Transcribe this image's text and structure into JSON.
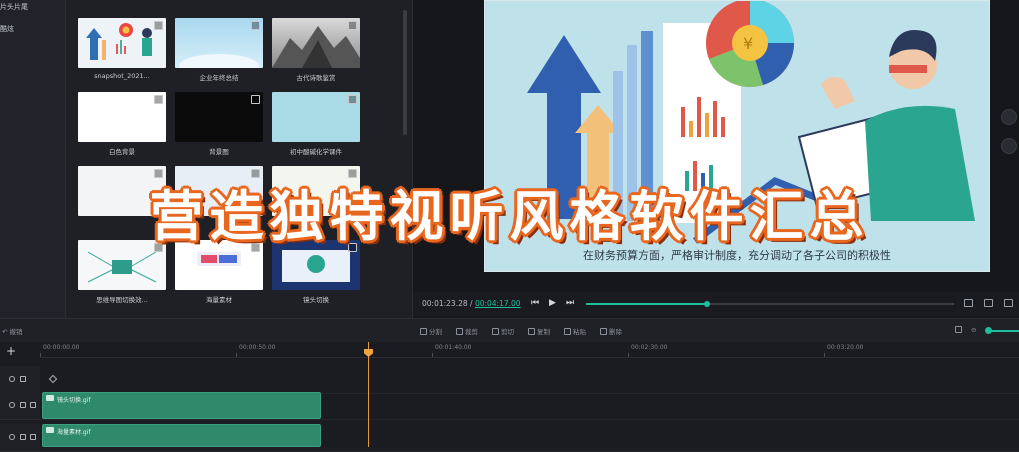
{
  "leftnav": {
    "items": [
      "片头片尾",
      "酷炫"
    ]
  },
  "media": {
    "items": [
      {
        "caption": "snapshot_2021...",
        "badge": "video"
      },
      {
        "caption": "企业年终总结",
        "badge": "video"
      },
      {
        "caption": "古代诗歌鉴赏",
        "badge": "video"
      },
      {
        "caption": "白色背景",
        "badge": "image"
      },
      {
        "caption": "背景图",
        "badge": "image"
      },
      {
        "caption": "初中酸碱化学课件",
        "badge": "video"
      },
      {
        "caption": "",
        "badge": "video"
      },
      {
        "caption": "",
        "badge": "video"
      },
      {
        "caption": "效果",
        "badge": "video"
      },
      {
        "caption": "思维导图切换效...",
        "badge": "video"
      },
      {
        "caption": "海量素材",
        "badge": "image"
      },
      {
        "caption": "镜头切换",
        "badge": "video"
      }
    ]
  },
  "preview": {
    "subtitle": "在财务预算方面，严格审计制度，充分调动了各子公司的积极性",
    "current_time": "00:01:23.28",
    "separator": "/",
    "total_time": "00:04:17.00",
    "progress": 0.33
  },
  "toolbar": {
    "undo": "撤销",
    "redo": "恢复",
    "split": "分割",
    "crop": "裁剪",
    "cut": "剪切",
    "copy": "复制",
    "paste": "粘贴",
    "delete": "删除"
  },
  "timeline": {
    "ruler": [
      "00:00:00.00",
      "00:00:50.00",
      "00:01:40.00",
      "00:02:30.00",
      "00:03:20.00"
    ],
    "clips": [
      {
        "label": "镜头切换.gif"
      },
      {
        "label": "海量素材.gif"
      }
    ]
  },
  "overlay": {
    "banner": "营造独特视听风格软件汇总"
  },
  "colors": {
    "accent": "#1fbf9b",
    "clip": "#2f8a6c",
    "playhead": "#e39a3b",
    "banner_outline": "#e8661e"
  }
}
